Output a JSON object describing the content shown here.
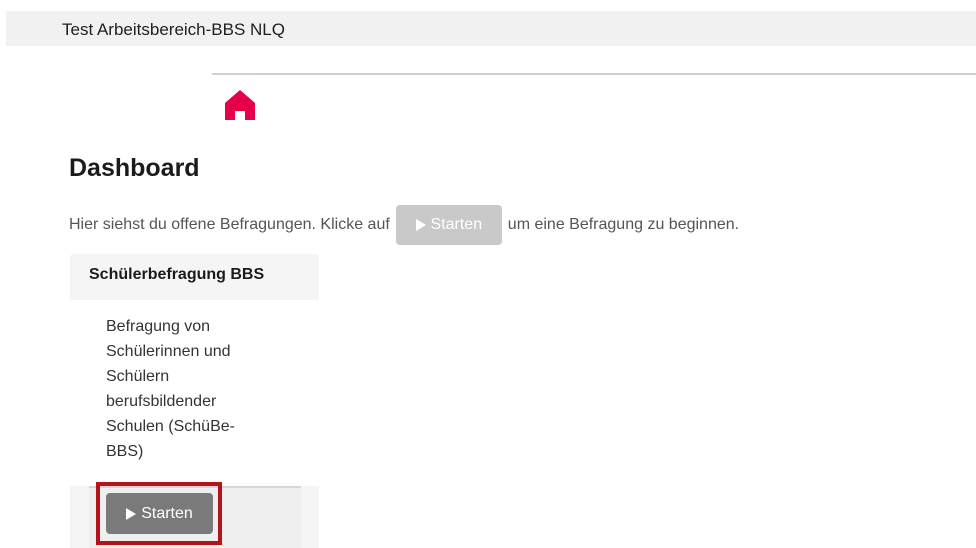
{
  "header": {
    "workspace_title": "Test Arbeitsbereich-BBS NLQ"
  },
  "nav": {
    "home_icon": "home-icon",
    "accent_color": "#e6004c"
  },
  "main": {
    "title": "Dashboard",
    "intro_before": "Hier siehst du offene Befragungen. Klicke auf",
    "intro_button_label": "Starten",
    "intro_after": "um eine Befragung zu beginnen."
  },
  "survey_card": {
    "title": "Schülerbefragung BBS",
    "description": "Befragung von Schülerinnen und Schülern berufsbildender Schulen (SchüBe-BBS)",
    "start_button_label": "Starten",
    "highlight_color": "#b5121b"
  }
}
